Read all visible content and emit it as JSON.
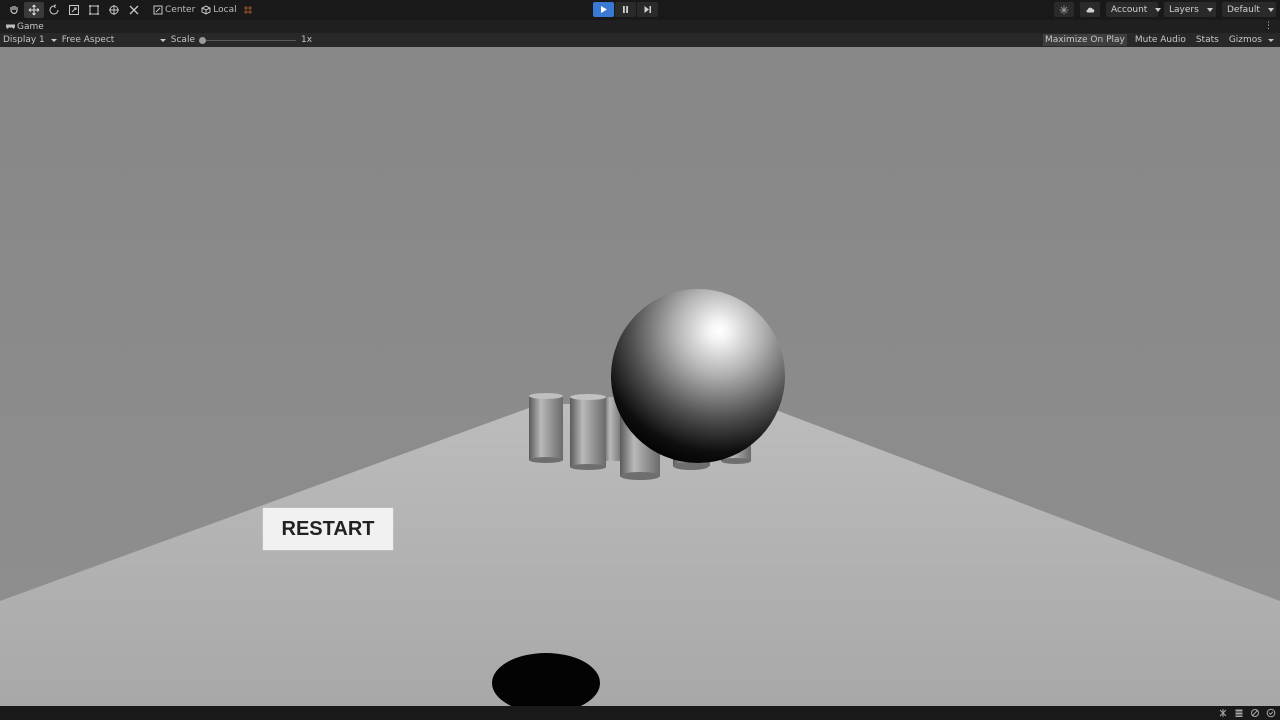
{
  "toolbar": {
    "tools": [
      "hand-tool",
      "move-tool",
      "rotate-tool",
      "scale-tool",
      "rect-tool",
      "transform-tool",
      "custom-tool"
    ],
    "pivot_label": "Center",
    "space_label": "Local",
    "account_label": "Account",
    "layers_label": "Layers",
    "layout_label": "Default"
  },
  "tab": {
    "title": "Game"
  },
  "gamebar": {
    "display": "Display 1",
    "aspect": "Free Aspect",
    "scale_label": "Scale",
    "scale_value": "1x",
    "maximize": "Maximize On Play",
    "mute": "Mute Audio",
    "stats": "Stats",
    "gizmos": "Gizmos"
  },
  "game": {
    "restart_label": "RESTART"
  },
  "colors": {
    "sky": "#8a8a8a",
    "ground": "#b4b4b4",
    "play_active": "#3a79d4",
    "editor_bg": "#191919"
  }
}
